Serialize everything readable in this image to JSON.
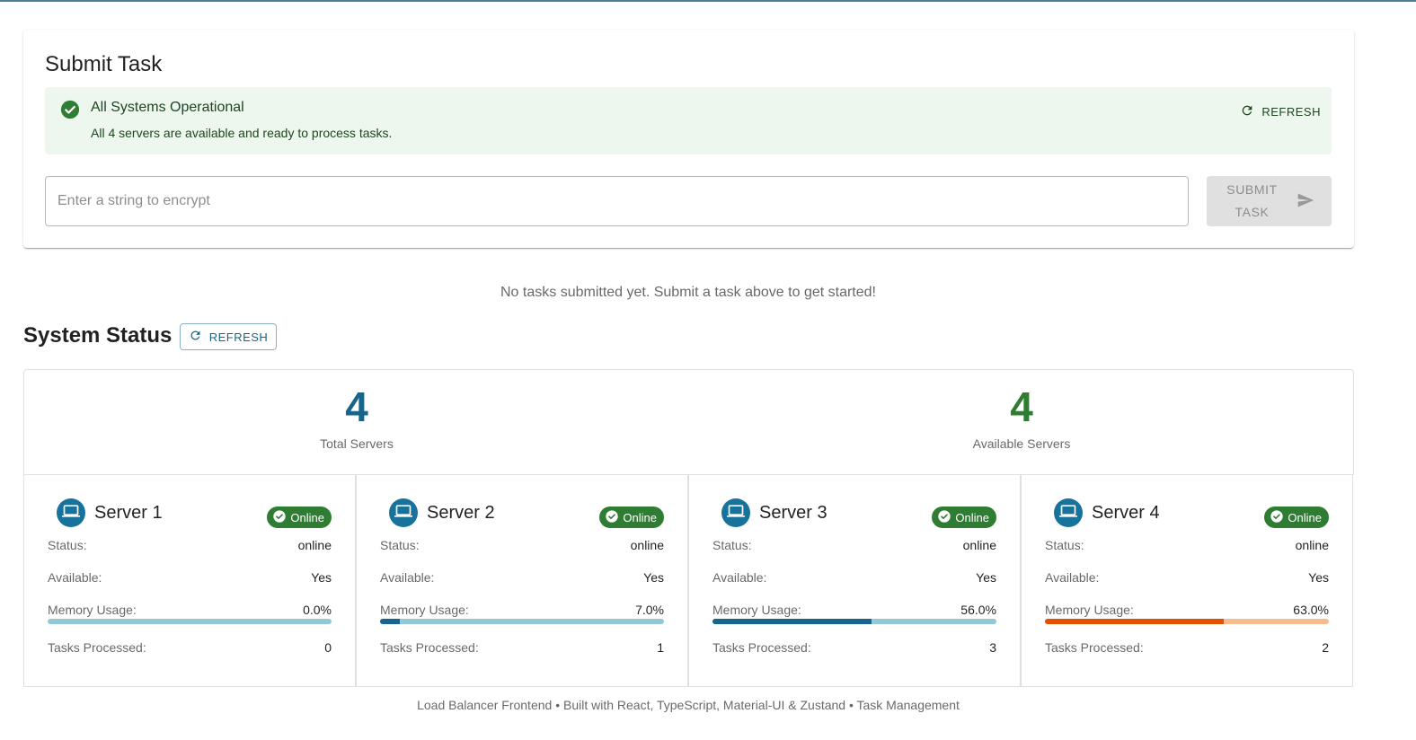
{
  "submit": {
    "title": "Submit Task",
    "alert": {
      "title": "All Systems Operational",
      "text": "All 4 servers are available and ready to process tasks.",
      "refresh_label": "REFRESH",
      "color": "#1e4620"
    },
    "input_placeholder": "Enter a string to encrypt",
    "input_value": "",
    "button_label": "SUBMIT TASK"
  },
  "empty_message": "No tasks submitted yet. Submit a task above to get started!",
  "status": {
    "title": "System Status",
    "refresh_label": "REFRESH",
    "total": {
      "value": "4",
      "label": "Total Servers",
      "color": "#15658c"
    },
    "available": {
      "value": "4",
      "label": "Available Servers",
      "color": "#2e7d32"
    }
  },
  "labels": {
    "status": "Status:",
    "available": "Available:",
    "memory": "Memory Usage:",
    "tasks": "Tasks Processed:"
  },
  "servers": [
    {
      "name": "Server 1",
      "chip": "Online",
      "status": "online",
      "available": "Yes",
      "memory_text": "0.0%",
      "memory": 0.0,
      "tasks": "0",
      "bar_color": "#15658c",
      "track_color": "#93c9d6"
    },
    {
      "name": "Server 2",
      "chip": "Online",
      "status": "online",
      "available": "Yes",
      "memory_text": "7.0%",
      "memory": 7.0,
      "tasks": "1",
      "bar_color": "#15658c",
      "track_color": "#93c9d6"
    },
    {
      "name": "Server 3",
      "chip": "Online",
      "status": "online",
      "available": "Yes",
      "memory_text": "56.0%",
      "memory": 56.0,
      "tasks": "3",
      "bar_color": "#15658c",
      "track_color": "#93c9d6"
    },
    {
      "name": "Server 4",
      "chip": "Online",
      "status": "online",
      "available": "Yes",
      "memory_text": "63.0%",
      "memory": 63.0,
      "tasks": "2",
      "bar_color": "#e65100",
      "track_color": "#f7bb8f"
    }
  ],
  "footer": "Load Balancer Frontend • Built with React, TypeScript, Material-UI & Zustand • Task Management",
  "icons": {
    "alert": "check-circle-icon",
    "refresh": "refresh-icon",
    "send": "send-icon",
    "server": "computer-icon",
    "chip": "check-circle-icon"
  }
}
